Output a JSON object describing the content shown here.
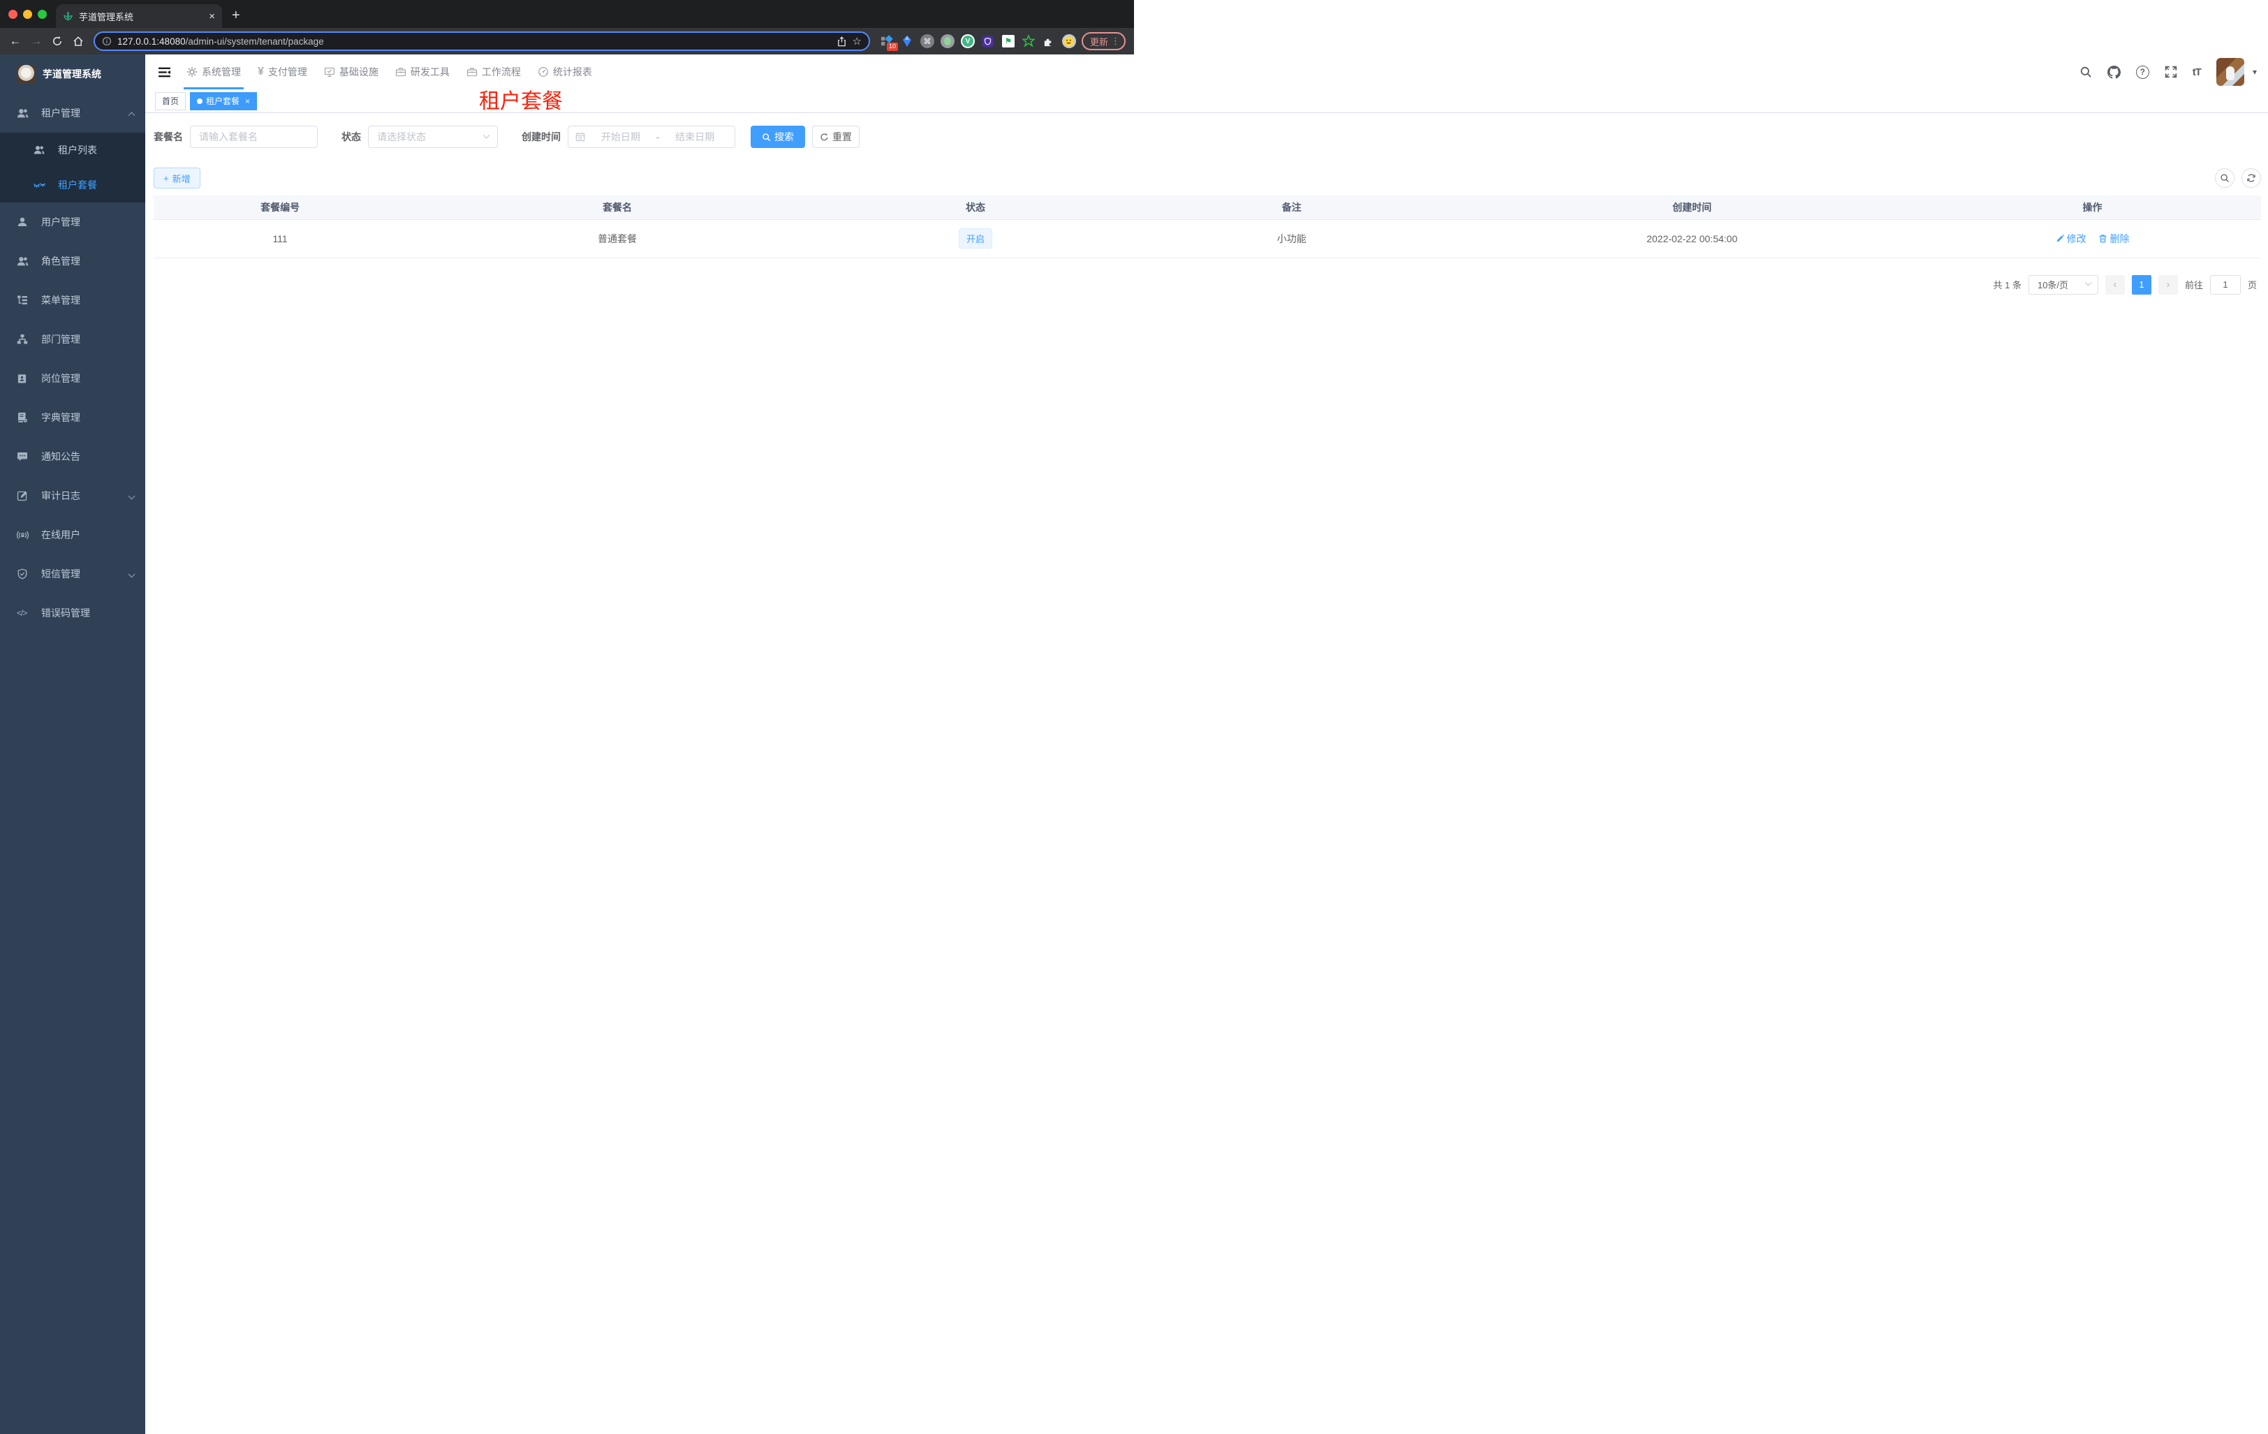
{
  "browser": {
    "tab_title": "芋道管理系统",
    "url_host": "127.0.0.1:48080",
    "url_path": "/admin-ui/system/tenant/package",
    "update_label": "更新",
    "extension_badge": "10"
  },
  "glyphs": {
    "back": "←",
    "forward": "→",
    "plus": "+",
    "close": "×",
    "star": "☆",
    "yen": "¥",
    "question": "?",
    "text_size": "tT",
    "caret_down": "▾",
    "command": "⌘",
    "flag": "⚑",
    "v_letter": "V",
    "code": "</>",
    "ellipsis_v": "⋮",
    "prev": "‹",
    "next": "›"
  },
  "colors": {
    "accent_blue": "#409eff",
    "sidebar_bg": "#304156",
    "submenu_bg": "#1f2d3d",
    "red_title": "#f7230c",
    "tag_active": "#3d9bfb"
  },
  "nav": {
    "items": [
      {
        "label": "系统管理"
      },
      {
        "label": "支付管理"
      },
      {
        "label": "基础设施"
      },
      {
        "label": "研发工具"
      },
      {
        "label": "工作流程"
      },
      {
        "label": "统计报表"
      }
    ]
  },
  "sidebar": {
    "app_title": "芋道管理系统",
    "items": [
      {
        "label": "租户管理"
      },
      {
        "label": "租户列表"
      },
      {
        "label": "租户套餐"
      },
      {
        "label": "用户管理"
      },
      {
        "label": "角色管理"
      },
      {
        "label": "菜单管理"
      },
      {
        "label": "部门管理"
      },
      {
        "label": "岗位管理"
      },
      {
        "label": "字典管理"
      },
      {
        "label": "通知公告"
      },
      {
        "label": "审计日志"
      },
      {
        "label": "在线用户"
      },
      {
        "label": "短信管理"
      },
      {
        "label": "错误码管理"
      }
    ]
  },
  "tags": {
    "home": "首页",
    "active": "租户套餐"
  },
  "page": {
    "red_title": "租户套餐"
  },
  "filters": {
    "name_label": "套餐名",
    "name_placeholder": "请输入套餐名",
    "status_label": "状态",
    "status_placeholder": "请选择状态",
    "date_label": "创建时间",
    "date_start": "开始日期",
    "date_sep": "-",
    "date_end": "结束日期",
    "search": "搜索",
    "reset": "重置"
  },
  "toolbar": {
    "add": "新增"
  },
  "table": {
    "headers": [
      "套餐编号",
      "套餐名",
      "状态",
      "备注",
      "创建时间",
      "操作"
    ],
    "rows": [
      {
        "id": "111",
        "name": "普通套餐",
        "status": "开启",
        "remark": "小功能",
        "created": "2022-02-22 00:54:00",
        "edit": "修改",
        "delete": "删除"
      }
    ]
  },
  "pagination": {
    "total": "共 1 条",
    "page_size": "10条/页",
    "current": "1",
    "goto": "前往",
    "goto_value": "1",
    "unit": "页"
  }
}
